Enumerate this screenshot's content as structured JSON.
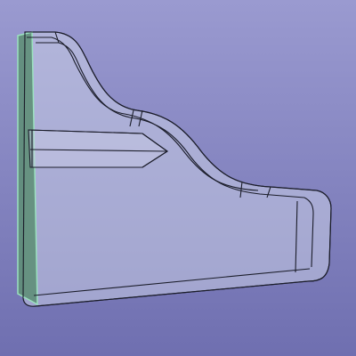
{
  "viewport": {
    "background_top_color": "#9a9ad0",
    "background_bottom_color": "#6f6fb0"
  },
  "part": {
    "body_fill_color": "#c9cde6",
    "body_fill_opacity": 0.55,
    "edge_color": "#1b1d2a",
    "highlight_edge_color": "#e9ecff",
    "selected_face_color": "#5f8f78",
    "selected_face_edge_color": "#9be2bf"
  }
}
